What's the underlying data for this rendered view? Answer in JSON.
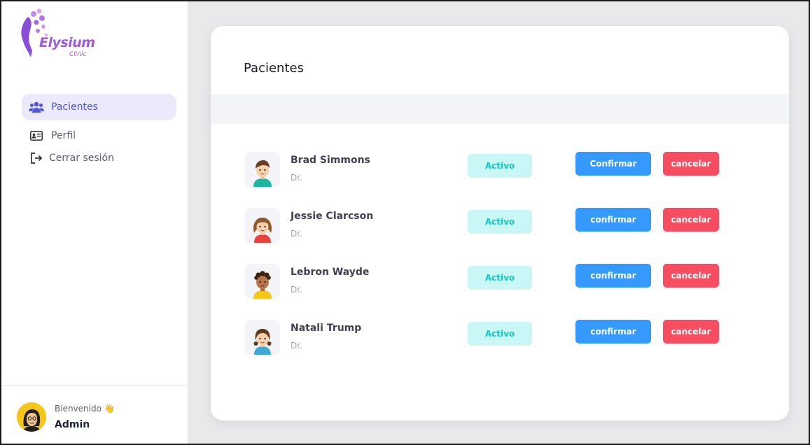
{
  "sidebar": {
    "logo": {
      "name": "Elysium",
      "sub": "Clinic"
    },
    "nav": [
      {
        "label": "Pacientes",
        "icon": "users-icon",
        "active": true
      },
      {
        "label": "Perfil",
        "icon": "id-card-icon",
        "active": false
      },
      {
        "label": "Cerrar sesión",
        "icon": "logout-icon",
        "active": false
      }
    ],
    "footer": {
      "welcome": "Bienvenido 👋",
      "user": "Admin"
    }
  },
  "main": {
    "title": "Pacientes",
    "patients": [
      {
        "name": "Brad Simmons",
        "role": "Dr.",
        "status": "Activo",
        "confirm": "Confirmar",
        "cancel": "cancelar"
      },
      {
        "name": "Jessie Clarcson",
        "role": "Dr.",
        "status": "Activo",
        "confirm": "confirmar",
        "cancel": "cancelar"
      },
      {
        "name": "Lebron Wayde",
        "role": "Dr.",
        "status": "Activo",
        "confirm": "confirmar",
        "cancel": "cancelar"
      },
      {
        "name": "Natali Trump",
        "role": "Dr.",
        "status": "Activo",
        "confirm": "confirmar",
        "cancel": "cancelar"
      }
    ]
  },
  "colors": {
    "accent": "#4f56d8",
    "confirm": "#3699ff",
    "cancel": "#f64e60",
    "status_bg": "#c9f7f5",
    "status_text": "#1bc5bd",
    "brand": "#9d5bd8"
  }
}
